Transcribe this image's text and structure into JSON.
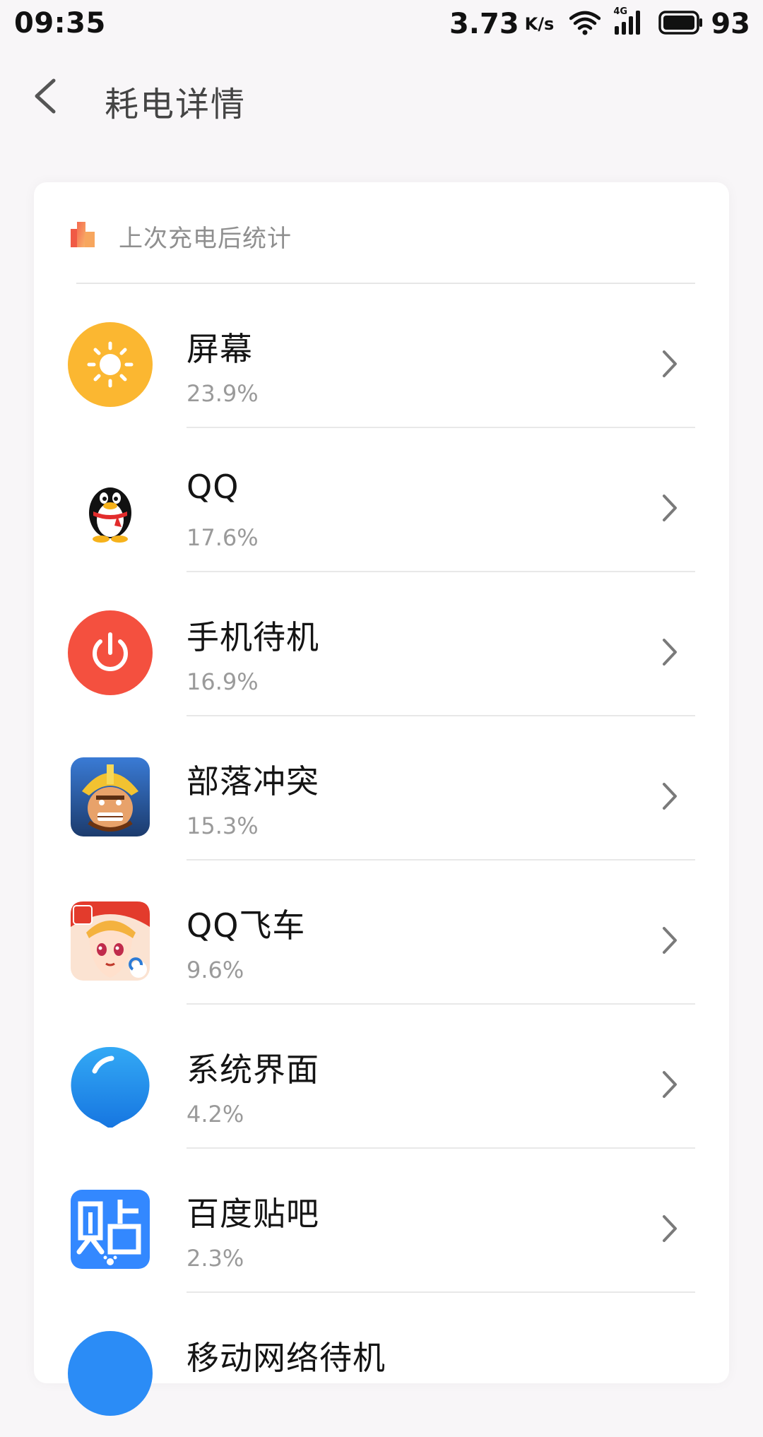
{
  "status_bar": {
    "time": "09:35",
    "net_speed": "3.73",
    "net_unit": "K/s",
    "network_type": "4G",
    "battery": "93",
    "icons": [
      "wifi-icon",
      "signal-icon",
      "battery-icon"
    ]
  },
  "app_bar": {
    "back_icon": "back-arrow-icon",
    "title": "耗电详情"
  },
  "section": {
    "icon": "bar-chart-icon",
    "title": "上次充电后统计"
  },
  "items": [
    {
      "name": "屏幕",
      "percent": "23.9%",
      "icon": "screen-brightness-icon",
      "color": "#fbb731"
    },
    {
      "name": "QQ",
      "percent": "17.6%",
      "icon": "qq-penguin-icon",
      "color": "#000000"
    },
    {
      "name": "手机待机",
      "percent": "16.9%",
      "icon": "power-icon",
      "color": "#f4503f"
    },
    {
      "name": "部落冲突",
      "percent": "15.3%",
      "icon": "clash-of-clans-icon",
      "color": "#2f5f9d"
    },
    {
      "name": "QQ飞车",
      "percent": "9.6%",
      "icon": "qq-speed-icon",
      "color": "#e33b2c"
    },
    {
      "name": "系统界面",
      "percent": "4.2%",
      "icon": "system-ui-icon",
      "color": "#2196f3"
    },
    {
      "name": "百度贴吧",
      "percent": "2.3%",
      "icon": "baidu-tieba-icon",
      "color": "#3388ff"
    },
    {
      "name": "移动网络待机",
      "percent": "",
      "icon": "mobile-network-icon",
      "color": "#2b8cf6"
    }
  ],
  "colors": {
    "background": "#f8f6f8",
    "card": "#ffffff",
    "secondary_text": "#9a9a9a"
  }
}
